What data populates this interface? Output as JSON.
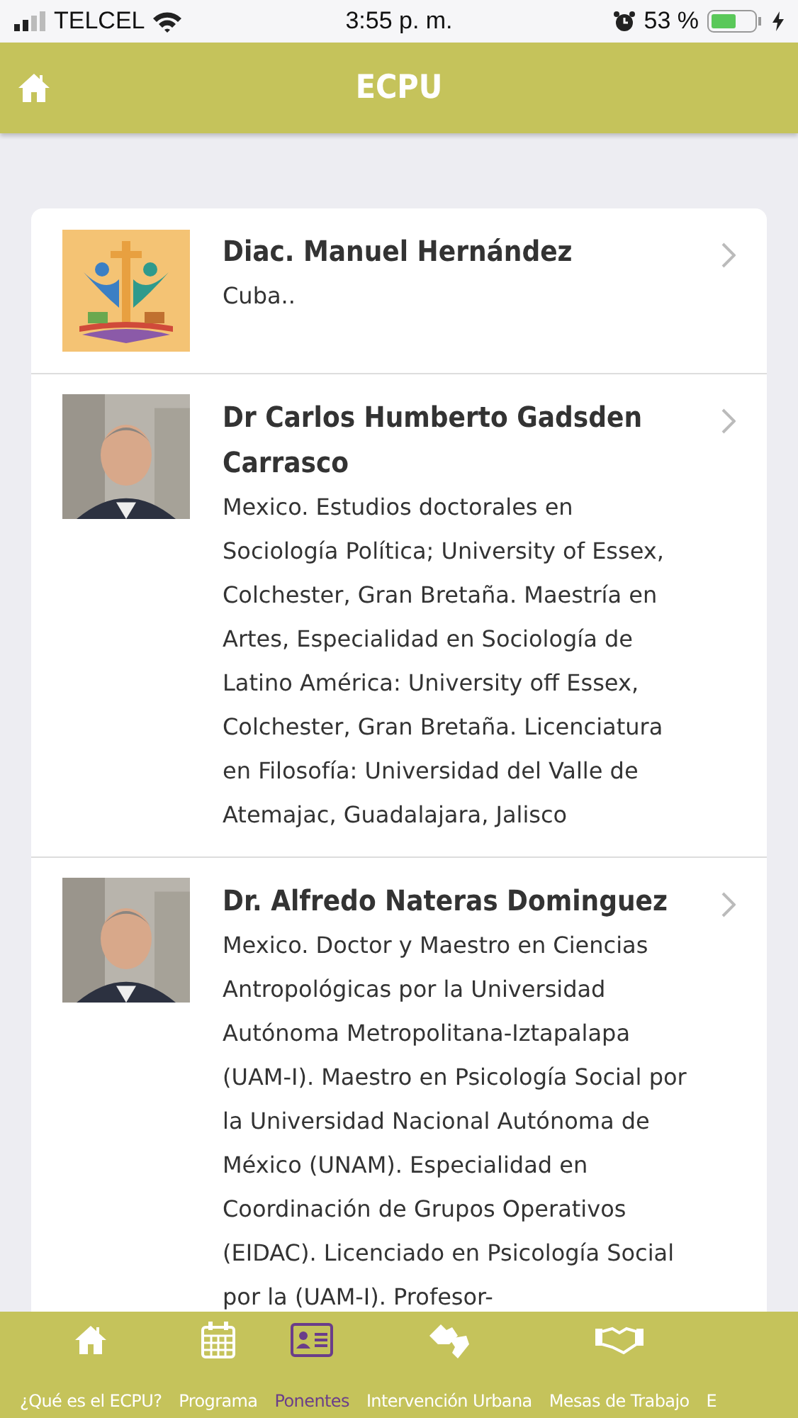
{
  "status_bar": {
    "carrier": "TELCEL",
    "time": "3:55 p. m.",
    "battery": "53 %"
  },
  "header": {
    "title": "ECPU"
  },
  "speakers": [
    {
      "name": "Diac. Manuel Hernández",
      "description": "Cuba..",
      "kind": "logo"
    },
    {
      "name": "Dr Carlos Humberto Gadsden Carrasco",
      "description": "Mexico. Estudios doctorales en Sociología Política; University of Essex, Colchester, Gran Bretaña. Maestría en Artes, Especialidad en Sociología de Latino América: University off Essex, Colchester, Gran Bretaña. Licenciatura en Filosofía: Universidad del Valle de Atemajac, Guadalajara, Jalisco",
      "kind": "picture"
    },
    {
      "name": "Dr. Alfredo Nateras Dominguez",
      "description": "Mexico. Doctor y Maestro en Ciencias Antropológicas por la Universidad Autónoma Metropolitana-Iztapalapa (UAM-I). Maestro en Psicología Social por la Universidad Nacional Autónoma de México (UNAM). Especialidad en Coordinación de Grupos Operativos (EIDAC). Licenciado en Psicología Social por la (UAM-I). Profesor-",
      "kind": "picture"
    }
  ],
  "tabs": [
    {
      "label": "¿Qué es el ECPU?",
      "selected": false
    },
    {
      "label": "Programa",
      "selected": false
    },
    {
      "label": "Ponentes",
      "selected": true
    },
    {
      "label": "Intervención Urbana",
      "selected": false
    },
    {
      "label": "Mesas de Trabajo",
      "selected": false
    },
    {
      "label": "E",
      "selected": false
    }
  ]
}
